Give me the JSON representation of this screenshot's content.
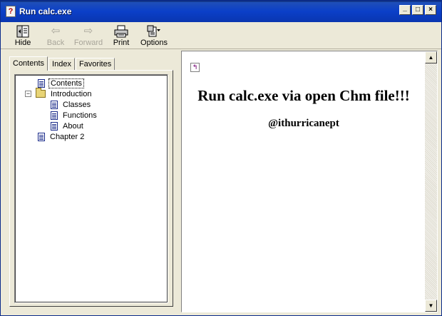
{
  "window": {
    "title": "Run calc.exe",
    "controls": {
      "minimize": "_",
      "maximize": "□",
      "close": "×"
    }
  },
  "toolbar": {
    "buttons": [
      {
        "label": "Hide",
        "icon": "hide-icon",
        "enabled": true
      },
      {
        "label": "Back",
        "icon": "back-arrow-icon",
        "enabled": false
      },
      {
        "label": "Forward",
        "icon": "forward-arrow-icon",
        "enabled": false
      },
      {
        "label": "Print",
        "icon": "printer-icon",
        "enabled": true
      },
      {
        "label": "Options",
        "icon": "options-icon",
        "enabled": true
      }
    ]
  },
  "nav": {
    "tabs": [
      {
        "label": "Contents",
        "active": true
      },
      {
        "label": "Index",
        "active": false
      },
      {
        "label": "Favorites",
        "active": false
      }
    ],
    "tree": [
      {
        "label": "Contents",
        "type": "page",
        "level": 0,
        "selected": true
      },
      {
        "label": "Introduction",
        "type": "folder",
        "level": 0,
        "expanded": true
      },
      {
        "label": "Classes",
        "type": "page",
        "level": 1
      },
      {
        "label": "Functions",
        "type": "page",
        "level": 1
      },
      {
        "label": "About",
        "type": "page",
        "level": 1
      },
      {
        "label": "Chapter 2",
        "type": "page",
        "level": 0
      }
    ]
  },
  "content": {
    "heading": "Run calc.exe via open Chm file!!!",
    "subheading": "@ithurricanept"
  },
  "colors": {
    "titlebar": "#0b3fc8",
    "window_face": "#ece9d8",
    "content_bg": "#ffffff"
  }
}
